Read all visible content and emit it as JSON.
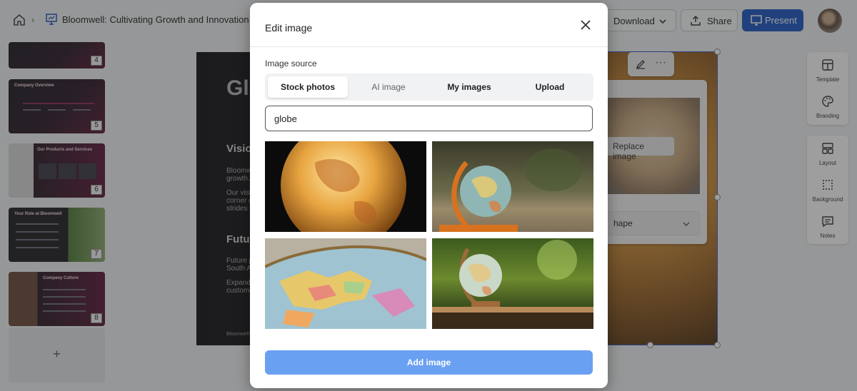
{
  "header": {
    "deck_title": "Bloomwell: Cultivating Growth and Innovation",
    "download_label": "Download",
    "share_label": "Share",
    "present_label": "Present",
    "breadcrumb_separator": "›"
  },
  "thumbnails": [
    {
      "number": "4",
      "title": ""
    },
    {
      "number": "5",
      "title": "Company Overview"
    },
    {
      "number": "6",
      "title": "Our Products and Services"
    },
    {
      "number": "7",
      "title": "Your Role at Bloomwell"
    },
    {
      "number": "8",
      "title": "Company Culture"
    }
  ],
  "add_slide_label": "+",
  "slide": {
    "title_partial": "Glo",
    "vision_heading": "Visio",
    "vision_lines": [
      "Bloomwe",
      "growth.",
      "Our visi",
      "corner o",
      "strides t"
    ],
    "future_heading": "Futu",
    "future_lines": [
      "Future p",
      "South A",
      "Expand",
      "custome"
    ],
    "footer": "Bloomwell"
  },
  "image_panel": {
    "replace_label": "Replace image",
    "shape_label": "hape"
  },
  "rail": {
    "template": "Template",
    "branding": "Branding",
    "layout": "Layout",
    "background": "Background",
    "notes": "Notes"
  },
  "modal": {
    "title": "Edit image",
    "source_label": "Image source",
    "tabs": [
      "Stock photos",
      "AI image",
      "My images",
      "Upload"
    ],
    "active_tab": "Stock photos",
    "search_value": "globe",
    "add_button": "Add image"
  },
  "colors": {
    "primary": "#1a56c4",
    "add_button": "#6aa0f2",
    "selection": "#2f5bd0"
  }
}
